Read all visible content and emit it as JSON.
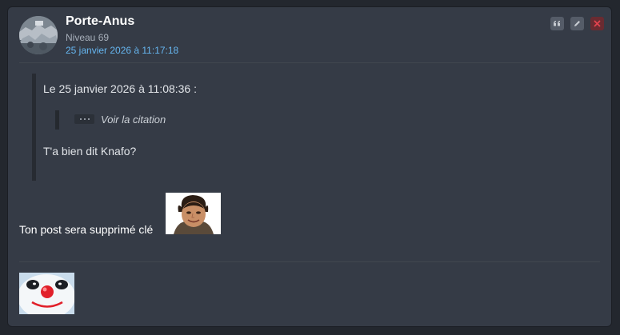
{
  "post": {
    "author": "Porte-Anus",
    "level": "Niveau 69",
    "date": "25 janvier 2026 à 11:17:18",
    "actions": {
      "quote_icon": "quote-icon",
      "edit_icon": "pencil-icon",
      "delete_icon": "close-icon"
    },
    "quote": {
      "header": "Le 25 janvier 2026 à 11:08:36 :",
      "nested_toggle_label": "Voir la citation",
      "text": "T'a bien dit Knafo?"
    },
    "message": "Ton post sera supprimé clé",
    "colors": {
      "background": "#23272e",
      "card": "#353b46",
      "date_link": "#66b6f0",
      "delete_button": "#6a2b31"
    }
  }
}
